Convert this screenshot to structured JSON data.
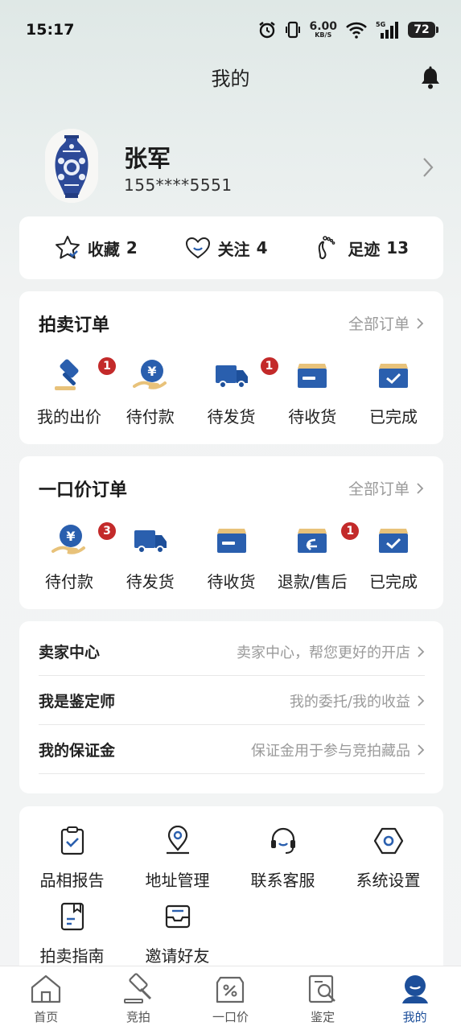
{
  "status_bar": {
    "time": "15:17",
    "net_speed_value": "6.00",
    "net_speed_unit": "KB/S",
    "battery": "72",
    "icons": [
      "alarm-icon",
      "vibrate-icon",
      "wifi-icon",
      "5g-signal-icon",
      "battery-icon"
    ]
  },
  "header": {
    "title": "我的",
    "bell_icon": "bell-icon"
  },
  "profile": {
    "name": "张军",
    "phone": "155****5551"
  },
  "stats": [
    {
      "label": "收藏",
      "count": "2",
      "icon": "star-icon"
    },
    {
      "label": "关注",
      "count": "4",
      "icon": "heart-icon"
    },
    {
      "label": "足迹",
      "count": "13",
      "icon": "footprint-icon"
    }
  ],
  "auction_orders": {
    "title": "拍卖订单",
    "more": "全部订单",
    "items": [
      {
        "label": "我的出价",
        "badge": "1",
        "icon": "gavel-icon"
      },
      {
        "label": "待付款",
        "badge": "",
        "icon": "yen-hand-icon"
      },
      {
        "label": "待发货",
        "badge": "1",
        "icon": "truck-icon"
      },
      {
        "label": "待收货",
        "badge": "",
        "icon": "box-icon"
      },
      {
        "label": "已完成",
        "badge": "",
        "icon": "box-check-icon"
      }
    ]
  },
  "fixed_orders": {
    "title": "一口价订单",
    "more": "全部订单",
    "items": [
      {
        "label": "待付款",
        "badge": "3",
        "icon": "yen-hand-icon"
      },
      {
        "label": "待发货",
        "badge": "",
        "icon": "truck-icon"
      },
      {
        "label": "待收货",
        "badge": "",
        "icon": "box-icon"
      },
      {
        "label": "退款/售后",
        "badge": "1",
        "icon": "box-return-icon"
      },
      {
        "label": "已完成",
        "badge": "",
        "icon": "box-check-icon"
      }
    ]
  },
  "menu": [
    {
      "label": "卖家中心",
      "desc": "卖家中心，帮您更好的开店"
    },
    {
      "label": "我是鉴定师",
      "desc": "我的委托/我的收益"
    },
    {
      "label": "我的保证金",
      "desc": "保证金用于参与竞拍藏品"
    }
  ],
  "tools": [
    {
      "label": "品相报告",
      "icon": "clipboard-check-icon"
    },
    {
      "label": "地址管理",
      "icon": "location-pin-icon"
    },
    {
      "label": "联系客服",
      "icon": "headset-icon"
    },
    {
      "label": "系统设置",
      "icon": "hexagon-settings-icon"
    },
    {
      "label": "拍卖指南",
      "icon": "guide-doc-icon"
    },
    {
      "label": "邀请好友",
      "icon": "inbox-invite-icon"
    }
  ],
  "tabbar": {
    "active": "我的",
    "tabs": [
      {
        "label": "首页",
        "icon": "home-icon"
      },
      {
        "label": "竞拍",
        "icon": "gavel-tab-icon"
      },
      {
        "label": "一口价",
        "icon": "price-tag-icon"
      },
      {
        "label": "鉴定",
        "icon": "appraise-search-icon"
      },
      {
        "label": "我的",
        "icon": "profile-icon"
      }
    ]
  },
  "colors": {
    "accent": "#1d4f9a",
    "badge": "#c32a2a",
    "order_icon_blue": "#2a5fae"
  }
}
